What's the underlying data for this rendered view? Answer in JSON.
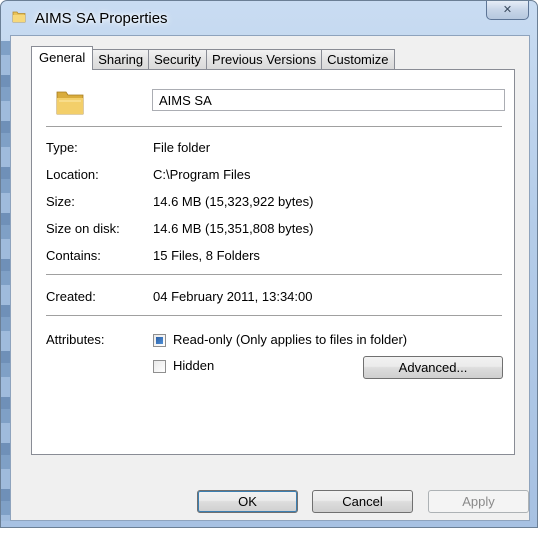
{
  "window": {
    "title": "AIMS SA Properties",
    "close_glyph": "✕"
  },
  "tabs": [
    {
      "label": "General",
      "active": true
    },
    {
      "label": "Sharing",
      "active": false
    },
    {
      "label": "Security",
      "active": false
    },
    {
      "label": "Previous Versions",
      "active": false
    },
    {
      "label": "Customize",
      "active": false
    }
  ],
  "general": {
    "name_value": "AIMS SA",
    "fields": [
      {
        "label": "Type:",
        "value": "File folder"
      },
      {
        "label": "Location:",
        "value": "C:\\Program Files"
      },
      {
        "label": "Size:",
        "value": "14.6 MB (15,323,922 bytes)"
      },
      {
        "label": "Size on disk:",
        "value": "14.6 MB (15,351,808 bytes)"
      },
      {
        "label": "Contains:",
        "value": "15 Files, 8 Folders"
      }
    ],
    "created_label": "Created:",
    "created_value": "04 February 2011, 13:34:00",
    "attributes_label": "Attributes:",
    "readonly_label": "Read-only (Only applies to files in folder)",
    "readonly_state": "indeterminate",
    "hidden_label": "Hidden",
    "hidden_checked": false,
    "advanced_label": "Advanced..."
  },
  "buttons": {
    "ok": "OK",
    "cancel": "Cancel",
    "apply": "Apply"
  },
  "icons": {
    "title_icon": "folder-icon",
    "large_icon": "folder-icon"
  }
}
